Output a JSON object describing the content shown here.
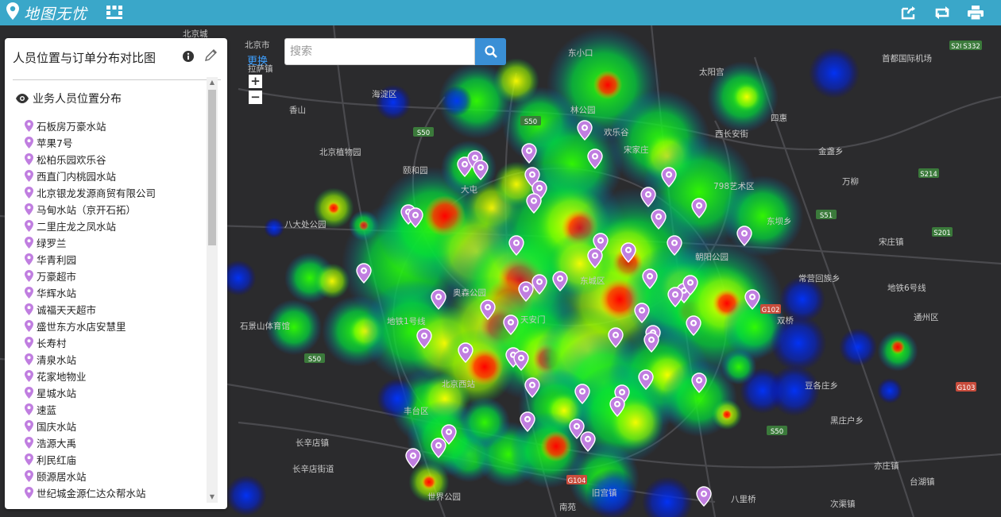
{
  "app": {
    "title": "地图无忧"
  },
  "topbar": {
    "icons": [
      "apps-grid-icon",
      "share-icon",
      "refresh-icon",
      "print-icon"
    ]
  },
  "panel": {
    "title": "人员位置与订单分布对比图",
    "layer": {
      "label": "业务人员位置分布",
      "icon": "eye-icon"
    },
    "items": [
      "石板房万豪水站",
      "苹果7号",
      "松柏乐园欢乐谷",
      "西直门内桃园水站",
      "北京银龙发源商贸有限公司",
      "马甸水站（京开石拓）",
      "二里庄龙之凤水站",
      "绿罗兰",
      "华青利园",
      "万豪超市",
      "华辉水站",
      "诚福天天超市",
      "盛世东方水店安慧里",
      "长寿村",
      "清泉水站",
      "花家地物业",
      "星城水站",
      "速蓝",
      "国庆水站",
      "浩源大禹",
      "利民红庙",
      "颐源居水站",
      "世纪城金源仁达众帮水站"
    ]
  },
  "map": {
    "switch_label": "更换",
    "search_placeholder": "搜索",
    "zoom_in": "+",
    "zoom_out": "−",
    "labels": [
      "北京市",
      "北京城",
      "东小口",
      "首都国际机场",
      "拉萨镇",
      "北京植物园",
      "颐和园",
      "林公园",
      "八大处公园",
      "798艺术区",
      "金盏乡",
      "东坝乡",
      "朝阳公园",
      "常营回族乡",
      "地铁6号线",
      "通州区",
      "石景山体育馆",
      "地铁1号线",
      "天安门",
      "丰台区",
      "长辛店镇",
      "长辛店街道",
      "世界公园",
      "南苑",
      "旧宫镇",
      "亦庄镇",
      "黑庄户乡",
      "台湖镇",
      "次渠镇",
      "豆各庄乡",
      "双桥",
      "宋庄镇",
      "香山",
      "海淀区",
      "北京西站",
      "东城区",
      "欢乐谷",
      "太阳宫",
      "奥森公园",
      "大屯",
      "宋家庄",
      "万柳",
      "西长安街",
      "四惠",
      "八里桥",
      "果园"
    ],
    "road_badges": [
      "S50",
      "S50",
      "S50",
      "S51",
      "S214",
      "S201",
      "S201",
      "S332",
      "G102",
      "G103",
      "G104",
      "S50"
    ],
    "colors": {
      "heat_low": "#0000ff",
      "heat_mid": "#00ff00",
      "heat_high": "#ff0000",
      "pin": "#c07ee0",
      "topbar": "#3aa7c9"
    }
  }
}
